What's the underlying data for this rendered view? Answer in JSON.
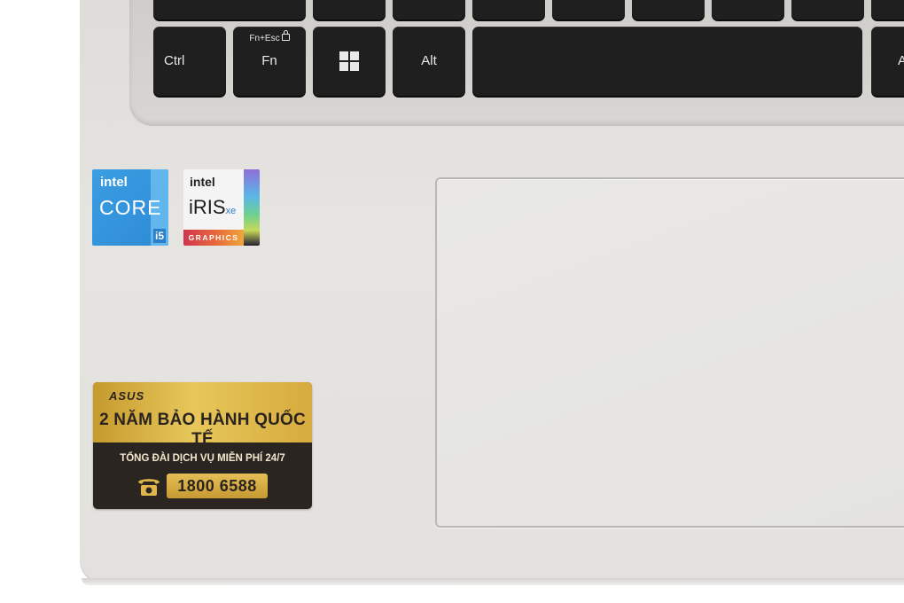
{
  "keyboard": {
    "keys": {
      "ctrl": "Ctrl",
      "fn_sub": "Fn+Esc",
      "fn": "Fn",
      "alt": "Alt",
      "alt_right": "A"
    }
  },
  "badges": {
    "core": {
      "brand": "intel",
      "name": "CORE",
      "tier": "i5"
    },
    "iris": {
      "brand": "intel",
      "name": "iRIS",
      "suffix": "xe",
      "sub": "GRAPHICS"
    }
  },
  "warranty": {
    "brand": "ASUS",
    "headline": "2 NĂM BẢO HÀNH QUỐC TẾ",
    "hotline_label": "TỔNG ĐÀI DỊCH VỤ MIỄN PHÍ 24/7",
    "phone": "1800 6588",
    "colors": {
      "gold": "#d7ab3e",
      "dark": "#2b2521"
    }
  }
}
